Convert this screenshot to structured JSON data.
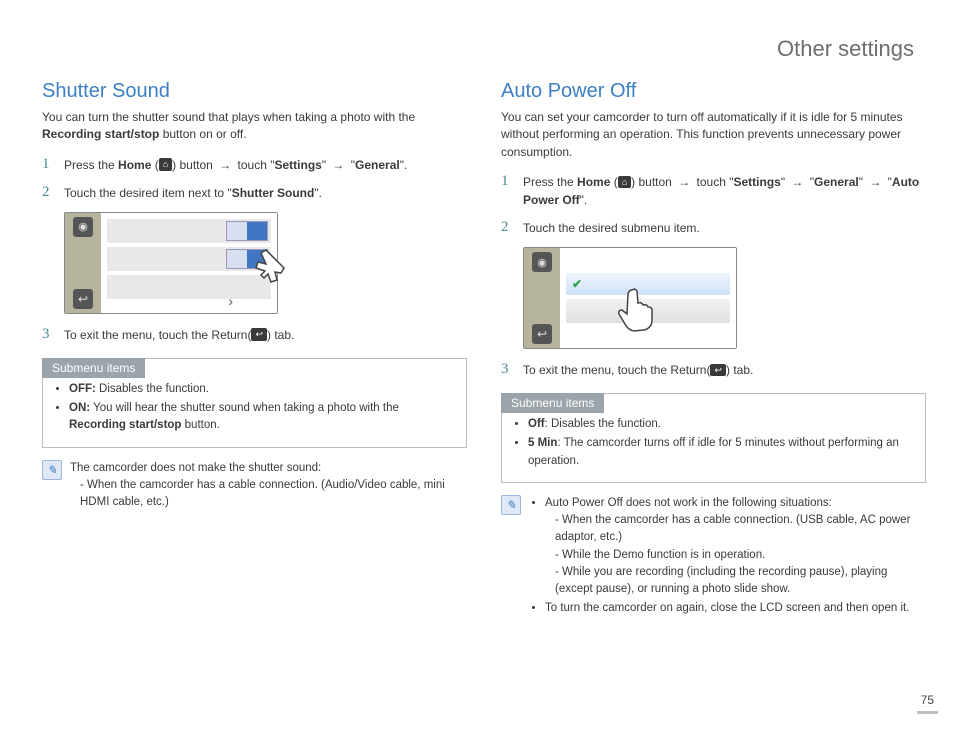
{
  "header": {
    "title": "Other settings"
  },
  "pagenum": "75",
  "left": {
    "heading": "Shutter Sound",
    "intro_a": "You can turn the shutter sound that plays when taking a photo with the ",
    "intro_b_bold": "Recording start/stop",
    "intro_c": " button on or off.",
    "step1_a": "Press the ",
    "step1_home": "Home",
    "step1_b": " (",
    "step1_c": ") button ",
    "step1_touch": " touch \"",
    "step1_settings": "Settings",
    "step1_mid": "\" ",
    "step1_gen": " \"",
    "step1_general": "General",
    "step1_end": "\".",
    "step2_a": "Touch the desired item next to \"",
    "step2_b": "Shutter Sound",
    "step2_c": "\".",
    "step3_a": "To exit the menu, touch the Return(",
    "step3_b": ") tab.",
    "sub_hdr": "Submenu items",
    "sub_off": "OFF:",
    "sub_off_txt": " Disables the function.",
    "sub_on": "ON:",
    "sub_on_txt_a": " You will hear the shutter sound when taking a photo with the ",
    "sub_on_txt_b": "Recording start/stop",
    "sub_on_txt_c": " button.",
    "note_a": "The camcorder does not make the shutter sound:",
    "note_b": "- When the camcorder has a cable connection. (Audio/Video cable, mini HDMI cable, etc.)"
  },
  "right": {
    "heading": "Auto Power Off",
    "intro": "You can set your camcorder to turn off automatically if it is idle for 5 minutes without performing an operation. This function prevents unnecessary power consumption.",
    "step1_a": "Press the ",
    "step1_home": "Home",
    "step1_b": " (",
    "step1_c": ") button ",
    "step1_touch": " touch \"",
    "step1_settings": "Settings",
    "step1_mid": "\" ",
    "step1_gen": " \"",
    "step1_general": "General",
    "step1_g2": "\" ",
    "step1_apo_q": " \"",
    "step1_apo": "Auto Power Off",
    "step1_end": "\".",
    "step2": "Touch the desired submenu item.",
    "step3_a": "To exit the menu, touch the Return(",
    "step3_b": ") tab.",
    "sub_hdr": "Submenu items",
    "sub_off": "Off",
    "sub_off_txt": ": Disables the function.",
    "sub_5": "5 Min",
    "sub_5_txt": ": The camcorder turns off if idle for 5 minutes without performing an operation.",
    "note1": "Auto Power Off does not work in the following situations:",
    "note1a": "- When the camcorder has a cable connection. (USB cable, AC power adaptor, etc.)",
    "note1b": "- While the Demo function is in operation.",
    "note1c": "- While you are recording (including the recording pause), playing (except pause), or running a photo slide show.",
    "note2": "To turn the camcorder on again, close the LCD screen and then open it."
  },
  "glyph": {
    "arrow": "→",
    "home": "⌂",
    "return": "↩"
  }
}
